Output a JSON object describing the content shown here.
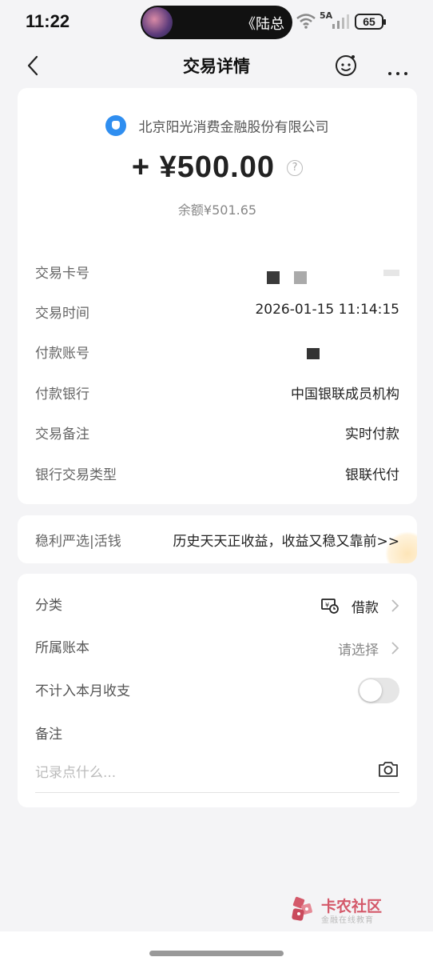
{
  "status_bar": {
    "time": "11:22",
    "island_text": "《陆总",
    "network_label": "5A",
    "battery": "65",
    "icons": [
      "wifi-icon",
      "signal-icon",
      "battery-icon"
    ]
  },
  "nav": {
    "title": "交易详情",
    "icons": [
      "back-icon",
      "customer-service-icon",
      "more-icon"
    ]
  },
  "transaction": {
    "merchant": "北京阳光消费金融股份有限公司",
    "amount": "+ ¥500.00",
    "balance": "余额¥501.65",
    "details": [
      {
        "label": "交易卡号",
        "value": ""
      },
      {
        "label": "交易时间",
        "value": "2026-01-15 11:14:15"
      },
      {
        "label": "付款账号",
        "value": ""
      },
      {
        "label": "付款银行",
        "value": "中国银联成员机构"
      },
      {
        "label": "交易备注",
        "value": "实时付款"
      },
      {
        "label": "银行交易类型",
        "value": "银联代付"
      }
    ]
  },
  "promo": {
    "label": "稳利严选|活钱",
    "text": "历史天天正收益，收益又稳又靠前>>"
  },
  "settings": {
    "category_label": "分类",
    "category_value": "借款",
    "ledger_label": "所属账本",
    "ledger_value": "请选择",
    "exclude_label": "不计入本月收支",
    "exclude_enabled": false,
    "note_label": "备注",
    "note_placeholder": "记录点什么..."
  },
  "watermark": {
    "title": "卡农社区",
    "subtitle": "金融在线教育"
  },
  "colors": {
    "accent_blue": "#2f8ef0",
    "watermark_red": "#d4596a",
    "background": "#f4f4f6"
  }
}
